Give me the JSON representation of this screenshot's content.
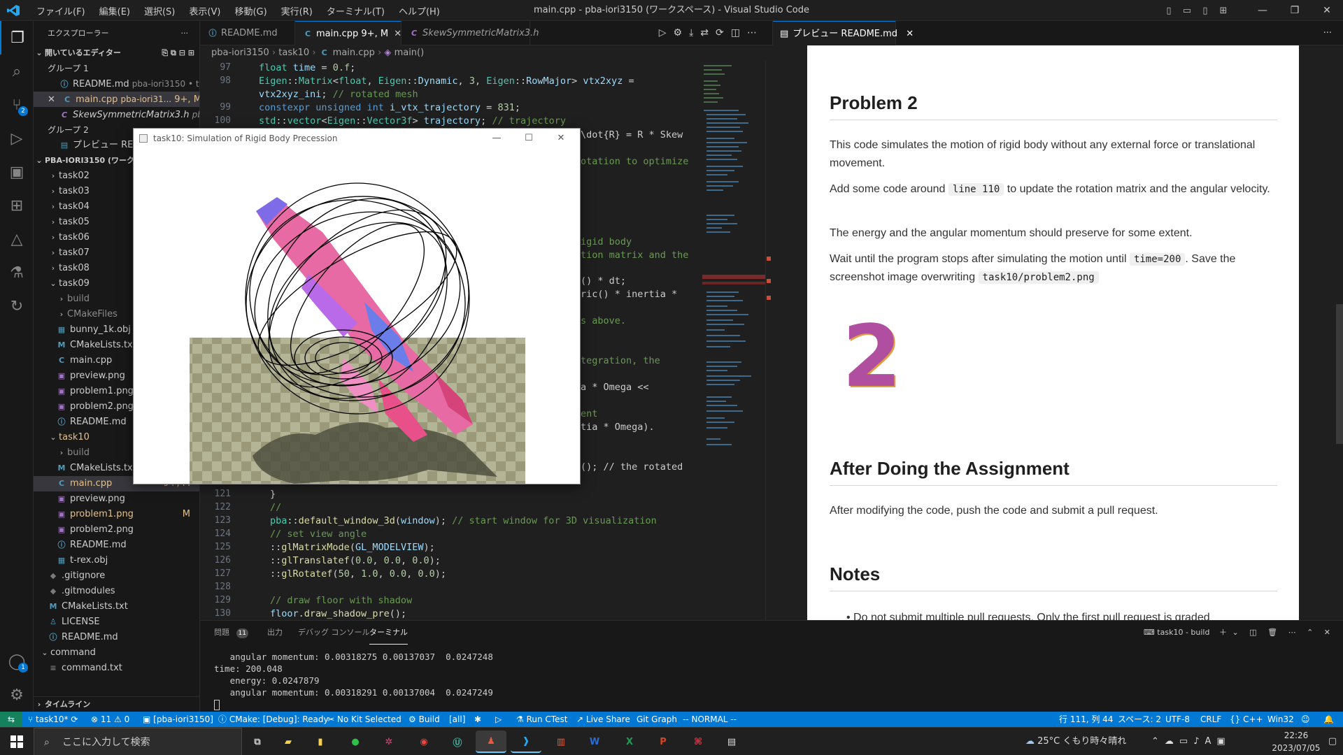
{
  "window": {
    "title": "main.cpp - pba-iori3150 (ワークスペース) - Visual Studio Code",
    "menu": [
      "ファイル(F)",
      "編集(E)",
      "選択(S)",
      "表示(V)",
      "移動(G)",
      "実行(R)",
      "ターミナル(T)",
      "ヘルプ(H)"
    ]
  },
  "activity_bar": {
    "scm_badge": "2",
    "accounts_badge": "1"
  },
  "explorer": {
    "header": "エクスプローラー",
    "open_editors": "開いているエディター",
    "group1": "グループ 1",
    "group2": "グループ 2",
    "open_files": [
      {
        "name": "README.md",
        "detail": "pba-iori3150 • t..."
      },
      {
        "name": "main.cpp",
        "detail": "pba-iori31...",
        "status": "9+, M"
      },
      {
        "name": "SkewSymmetricMatrix3.h",
        "detail": "pb..."
      },
      {
        "name": "プレビュー README.md",
        "detail": ""
      }
    ],
    "workspace": "PBA-IORI3150 (ワークスペ",
    "tree": [
      {
        "label": "task02",
        "kind": "folder"
      },
      {
        "label": "task03",
        "kind": "folder"
      },
      {
        "label": "task04",
        "kind": "folder"
      },
      {
        "label": "task05",
        "kind": "folder"
      },
      {
        "label": "task06",
        "kind": "folder"
      },
      {
        "label": "task07",
        "kind": "folder"
      },
      {
        "label": "task08",
        "kind": "folder"
      },
      {
        "label": "task09",
        "kind": "folder-open"
      },
      {
        "label": "build",
        "kind": "folder"
      },
      {
        "label": "CMakeFiles",
        "kind": "folder"
      },
      {
        "label": "bunny_1k.obj",
        "kind": "obj"
      },
      {
        "label": "CMakeLists.txt",
        "kind": "cm"
      },
      {
        "label": "main.cpp",
        "kind": "cpp"
      },
      {
        "label": "preview.png",
        "kind": "png"
      },
      {
        "label": "problem1.png",
        "kind": "png"
      },
      {
        "label": "problem2.png",
        "kind": "png"
      },
      {
        "label": "README.md",
        "kind": "md"
      },
      {
        "label": "task10",
        "kind": "folder-open"
      },
      {
        "label": "build",
        "kind": "folder"
      },
      {
        "label": "CMakeLists.txt",
        "kind": "cm"
      },
      {
        "label": "main.cpp",
        "kind": "cpp",
        "status": "9+, M"
      },
      {
        "label": "preview.png",
        "kind": "png"
      },
      {
        "label": "problem1.png",
        "kind": "png",
        "status": "M"
      },
      {
        "label": "problem2.png",
        "kind": "png"
      },
      {
        "label": "README.md",
        "kind": "md"
      },
      {
        "label": "t-rex.obj",
        "kind": "obj"
      },
      {
        "label": ".gitignore",
        "kind": "git"
      },
      {
        "label": ".gitmodules",
        "kind": "git"
      },
      {
        "label": "CMakeLists.txt",
        "kind": "cm"
      },
      {
        "label": "LICENSE",
        "kind": "lic"
      },
      {
        "label": "README.md",
        "kind": "md"
      },
      {
        "label": "command",
        "kind": "folder-open"
      },
      {
        "label": "command.txt",
        "kind": "txt"
      }
    ],
    "timeline": "タイムライン"
  },
  "tabs": [
    {
      "label": "README.md"
    },
    {
      "label": "main.cpp",
      "status": "9+, M"
    },
    {
      "label": "SkewSymmetricMatrix3.h"
    }
  ],
  "breadcrumb": [
    "pba-iori3150",
    "task10",
    "main.cpp",
    "main()"
  ],
  "code_lines": [
    {
      "n": "97",
      "text": "float time = 0.f;"
    },
    {
      "n": "98",
      "text": "Eigen::Matrix<float, Eigen::Dynamic, 3, Eigen::RowMajor> vtx2xyz ="
    },
    {
      "n": "",
      "text": "vtx2xyz_ini; // rotated mesh"
    },
    {
      "n": "99",
      "text": "constexpr unsigned int i_vtx_trajectory = 831;"
    },
    {
      "n": "100",
      "text": "std::vector<Eigen::Vector3f> trajectory; // trajectory"
    }
  ],
  "code_fragments": [
    "\\dot{R} = R * Skew",
    "otation to optimize",
    "igid body",
    "tion matrix and the",
    "() * dt;",
    "ric() * inertia *",
    "s above.",
    "tegration, the",
    "a * Omega <<",
    "ent",
    "tia * Omega).",
    "(); // the rotated"
  ],
  "code_lines_bottom": [
    {
      "n": "121",
      "text": "}"
    },
    {
      "n": "122",
      "text": "//"
    },
    {
      "n": "123",
      "text": "pba::default_window_3d(window); // start window for 3D visualization"
    },
    {
      "n": "124",
      "text": "// set view angle"
    },
    {
      "n": "125",
      "text": "::glMatrixMode(GL_MODELVIEW);"
    },
    {
      "n": "126",
      "text": "::glTranslatef(0.0, 0.0, 0.0);"
    },
    {
      "n": "127",
      "text": "::glRotatef(50, 1.0, 0.0, 0.0);"
    },
    {
      "n": "128",
      "text": ""
    },
    {
      "n": "129",
      "text": "// draw floor with shadow"
    },
    {
      "n": "130",
      "text": "floor.draw_shadow_pre();"
    }
  ],
  "app_window": {
    "title": "task10: Simulation of Rigid Body Precession"
  },
  "preview": {
    "tab": "プレビュー README.md",
    "h_problem2": "Problem 2",
    "p1": "This code simulates the motion of rigid body without any external force or translational movement.",
    "p2_a": "Add some code around ",
    "p2_code": "line 110",
    "p2_b": " to update the rotation matrix and the angular velocity.",
    "p3": "The energy and the angular momentum should preserve for some extent.",
    "p4_a": "Wait until the program stops after simulating the motion until ",
    "p4_code": "time=200",
    "p4_b": ". Save the screenshot image overwriting ",
    "p4_code2": "task10/problem2.png",
    "big_digit": "2",
    "h_after": "After Doing the Assignment",
    "p5": "After modifying the code, push the code and submit a pull request.",
    "h_notes": "Notes",
    "note1": "Do not submit multiple pull requests. Only the first pull request is graded"
  },
  "panel": {
    "tabs": [
      "問題",
      "出力",
      "デバッグ コンソール",
      "ターミナル"
    ],
    "problems_count": "11",
    "terminal_name": "task10 - build",
    "lines": [
      "   angular momentum: 0.00318275 0.00137037  0.0247248",
      "time: 200.048",
      "   energy: 0.0247879",
      "   angular momentum: 0.00318291 0.00137004  0.0247249"
    ]
  },
  "status_bar": {
    "branch": "task10*",
    "errors": "11",
    "warnings": "0",
    "workspace": "[pba-iori3150]",
    "cmake": "CMake: [Debug]: Ready",
    "kit": "No Kit Selected",
    "build": "Build",
    "all": "[all]",
    "ctest": "Run CTest",
    "liveshare": "Live Share",
    "gitgraph": "Git Graph",
    "vim": "-- NORMAL --",
    "position": "行 111, 列 44",
    "spaces": "スペース: 2",
    "encoding": "UTF-8",
    "eol": "CRLF",
    "language": "C++",
    "platform": "Win32"
  },
  "taskbar": {
    "search_placeholder": "ここに入力して検索",
    "weather": "25°C  くもり時々晴れ",
    "time": "22:26",
    "date": "2023/07/05"
  },
  "colors": {
    "accent": "#0078d4",
    "status_bar": "#0078d4",
    "modified": "#e2c08d"
  }
}
